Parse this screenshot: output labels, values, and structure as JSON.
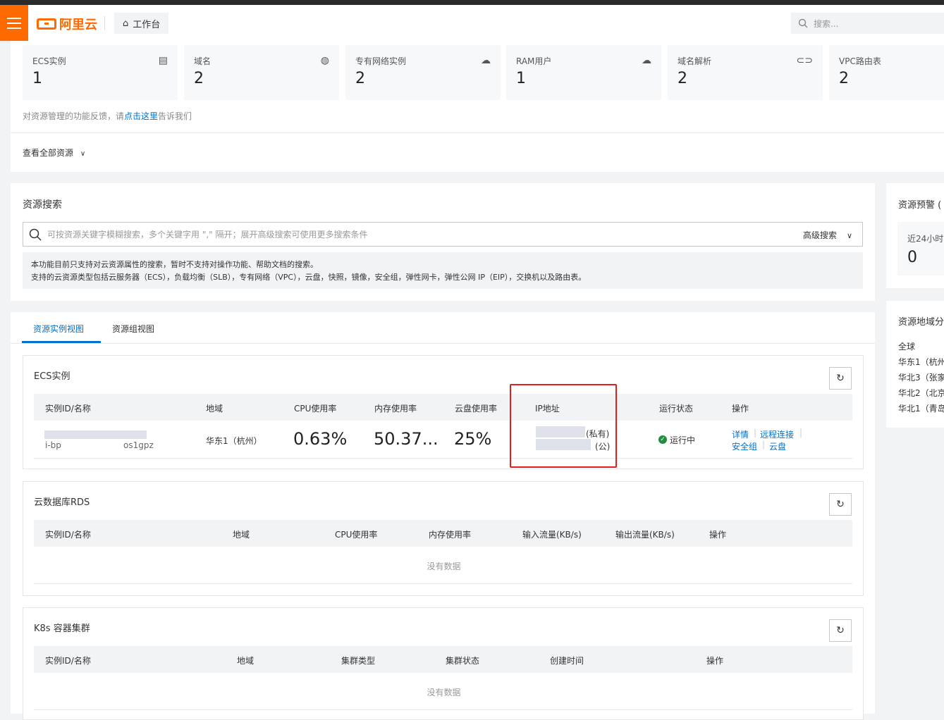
{
  "topbar": {
    "logo_text": "阿里云",
    "workbench_label": "工作台",
    "search_placeholder": "搜索..."
  },
  "stats": [
    {
      "label": "ECS实例",
      "value": "1",
      "icon": "server-icon"
    },
    {
      "label": "域名",
      "value": "2",
      "icon": "globe-icon"
    },
    {
      "label": "专有网络实例",
      "value": "2",
      "icon": "cloud-network-icon"
    },
    {
      "label": "RAM用户",
      "value": "1",
      "icon": "cloud-user-icon"
    },
    {
      "label": "域名解析",
      "value": "2",
      "icon": "dns-icon"
    },
    {
      "label": "VPC路由表",
      "value": "2",
      "icon": "route-table-icon"
    }
  ],
  "feedback": {
    "prefix": "对资源管理的功能反馈，请",
    "link": "点击这里",
    "suffix": "告诉我们"
  },
  "view_all": "查看全部资源",
  "resource_search": {
    "title": "资源搜索",
    "placeholder": "可按资源关键字模糊搜索，多个关键字用 \",\" 隔开；展开高级搜索可使用更多搜索条件",
    "advanced_label": "高级搜索",
    "note_line1": "本功能目前只支持对云资源属性的搜索，暂时不支持对操作功能、帮助文档的搜索。",
    "note_line2": "支持的云资源类型包括云服务器（ECS），负载均衡（SLB），专有网络（VPC），云盘，快照，镜像，安全组，弹性网卡，弹性公网 IP（EIP），交换机以及路由表。"
  },
  "tabs": [
    {
      "label": "资源实例视图",
      "active": true
    },
    {
      "label": "资源组视图",
      "active": false
    }
  ],
  "ecs": {
    "title": "ECS实例",
    "columns": [
      "实例ID/名称",
      "地域",
      "CPU使用率",
      "内存使用率",
      "云盘使用率",
      "IP地址",
      "运行状态",
      "操作"
    ],
    "row": {
      "id_prefix": "i-bp",
      "id_suffix": "os1gpz",
      "region": "华东1（杭州）",
      "cpu": "0.63%",
      "memory": "50.37...",
      "disk": "25%",
      "ip_private_tag": "(私有)",
      "ip_public_tag": "(公)",
      "status": "运行中",
      "actions": [
        "详情",
        "远程连接",
        "安全组",
        "云盘"
      ]
    }
  },
  "rds": {
    "title": "云数据库RDS",
    "columns": [
      "实例ID/名称",
      "地域",
      "CPU使用率",
      "内存使用率",
      "输入流量(KB/s)",
      "输出流量(KB/s)",
      "操作"
    ],
    "empty": "没有数据"
  },
  "k8s": {
    "title": "K8s 容器集群",
    "columns": [
      "实例ID/名称",
      "地域",
      "集群类型",
      "集群状态",
      "创建时间",
      "操作"
    ],
    "empty": "没有数据"
  },
  "side": {
    "alert_title": "资源预警",
    "alert_sub": "近24小时",
    "alert_value": "0",
    "region_title": "资源地域分",
    "regions": [
      "全球",
      "华东1（杭州",
      "华北3（张家",
      "华北2（北京",
      "华北1（青岛"
    ]
  },
  "colors": {
    "brand": "#ff6a00",
    "link": "#0070cc",
    "highlight": "#e02020",
    "running": "#1e8e3e"
  }
}
